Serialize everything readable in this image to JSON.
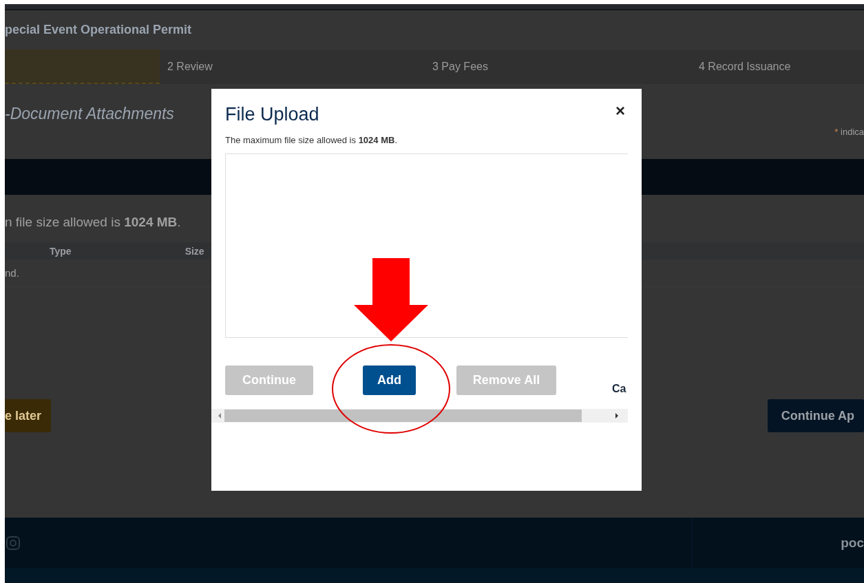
{
  "page": {
    "title": "pecial Event Operational Permit",
    "steps": [
      {
        "selected": true
      },
      {
        "label": "2 Review",
        "selected": false
      },
      {
        "label": "3 Pay Fees",
        "selected": false
      },
      {
        "label": "4 Record Issuance",
        "selected": false
      }
    ],
    "section_heading": "-Document Attachments",
    "required_note": {
      "mark": "*",
      "text": "indica"
    },
    "size_note": "n file size allowed is **1024 MB**.",
    "table": {
      "columns": [
        "Type",
        "Size"
      ],
      "empty_text": "nd."
    },
    "buttons": [
      {
        "label": "e later",
        "kind": "secondary"
      },
      {
        "label": "Continue Ap",
        "kind": "primary"
      }
    ],
    "footer": {
      "text": "poc"
    }
  },
  "dialog": {
    "title": "File Upload",
    "close": "×",
    "size_note": "The maximum file size allowed is **1024 MB**.",
    "buttons": [
      {
        "label": "Continue",
        "disabled": true
      },
      {
        "label": "Add",
        "disabled": false
      },
      {
        "label": "Remove All",
        "disabled": true
      }
    ],
    "cancel": "Ca"
  }
}
